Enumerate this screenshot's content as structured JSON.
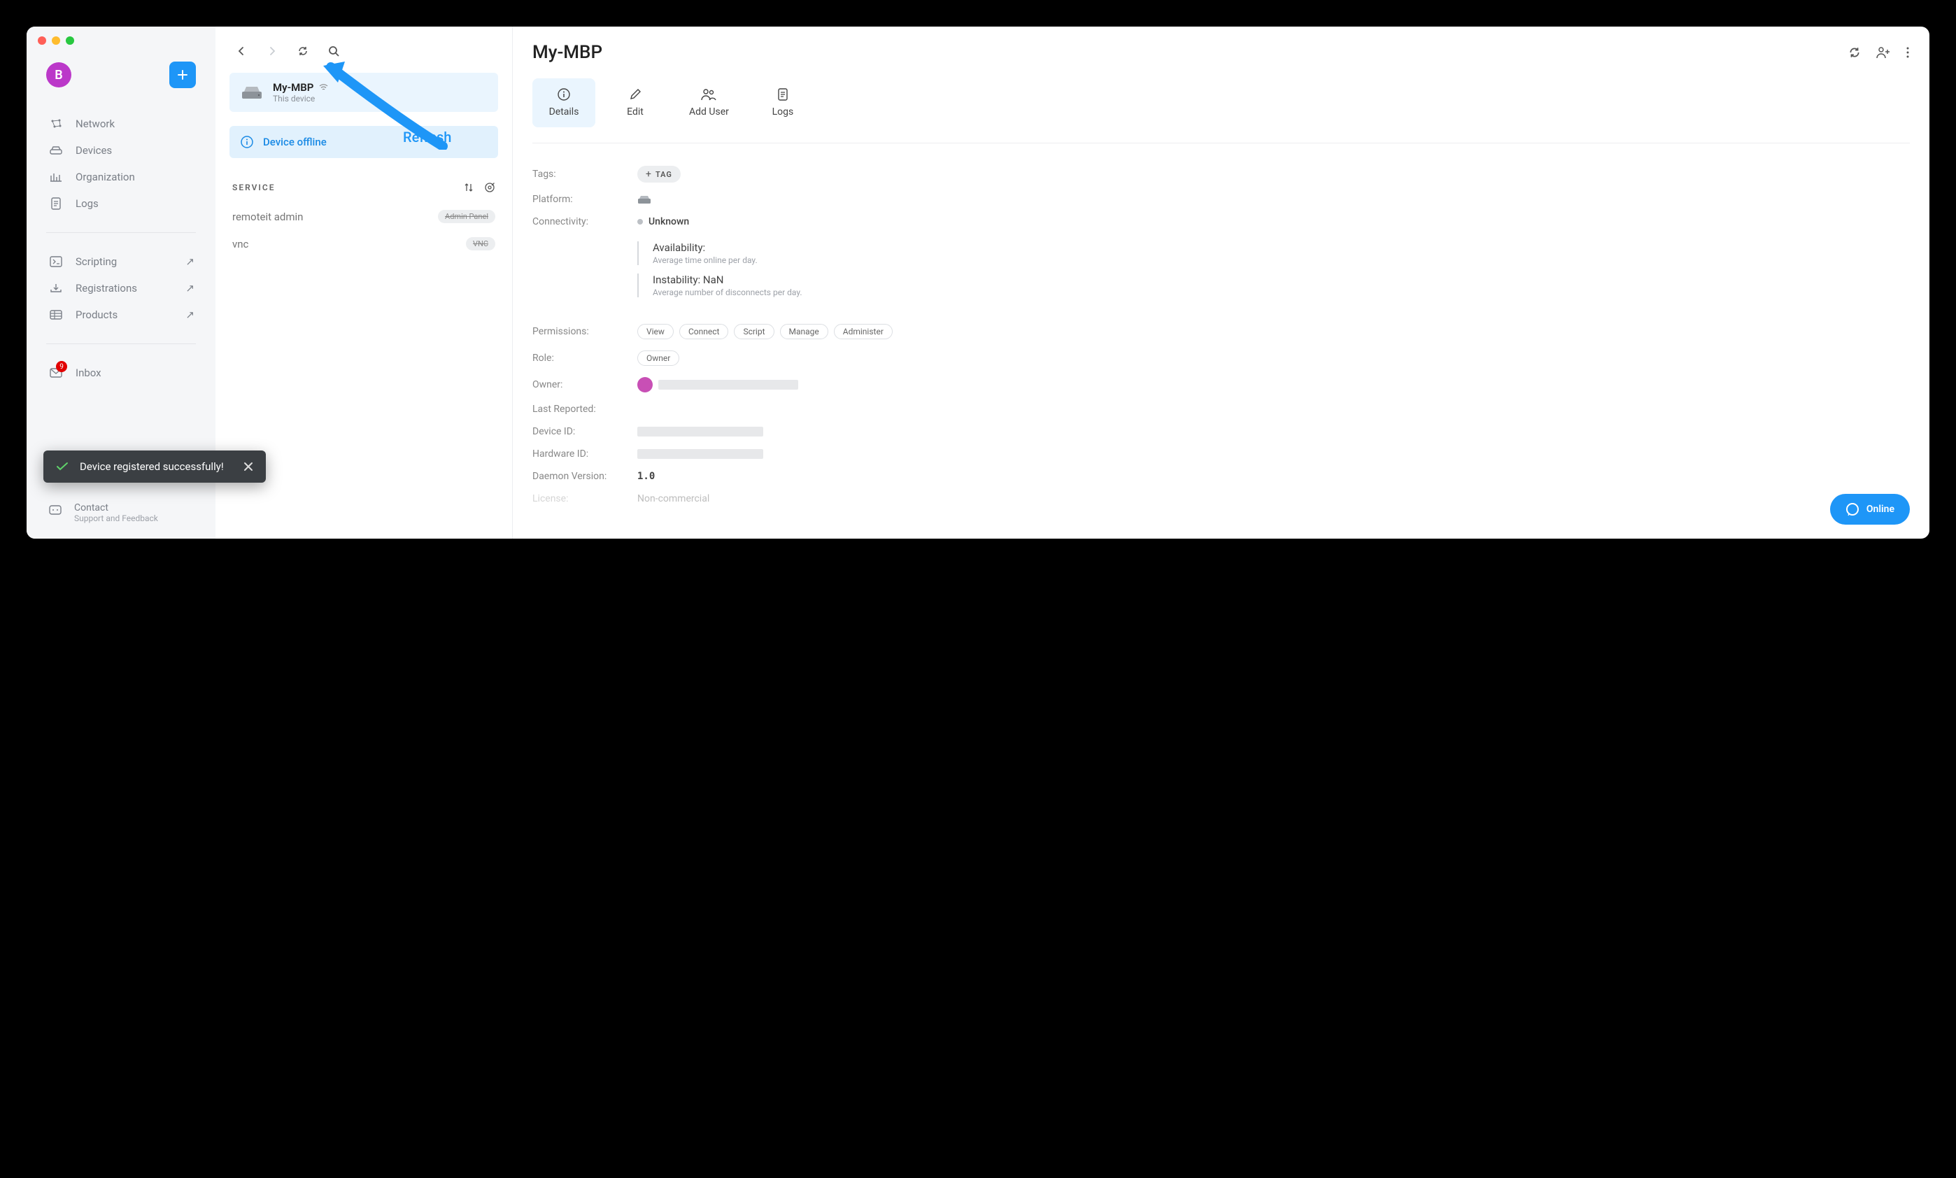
{
  "avatar_initial": "B",
  "sidebar": {
    "items": [
      {
        "label": "Network"
      },
      {
        "label": "Devices"
      },
      {
        "label": "Organization"
      },
      {
        "label": "Logs"
      }
    ],
    "items2": [
      {
        "label": "Scripting"
      },
      {
        "label": "Registrations"
      },
      {
        "label": "Products"
      }
    ],
    "inbox_label": "Inbox",
    "inbox_badge": "9",
    "contact_label": "Contact",
    "contact_sub": "Support and Feedback"
  },
  "middle": {
    "device_name": "My-MBP",
    "device_sub": "This device",
    "alert_text": "Device offline",
    "service_header": "SERVICE",
    "services": [
      {
        "name": "remoteit admin",
        "tag": "Admin Panel"
      },
      {
        "name": "vnc",
        "tag": "VNC"
      }
    ]
  },
  "annotation": {
    "refresh_label": "Refresh"
  },
  "right": {
    "title": "My-MBP",
    "tabs": [
      {
        "label": "Details"
      },
      {
        "label": "Edit"
      },
      {
        "label": "Add User"
      },
      {
        "label": "Logs"
      }
    ],
    "tags_label": "Tags:",
    "tag_btn": "TAG",
    "platform_label": "Platform:",
    "connectivity_label": "Connectivity:",
    "connectivity_value": "Unknown",
    "availability_title": "Availability:",
    "availability_sub": "Average time online per day.",
    "instability_title": "Instability: NaN",
    "instability_sub": "Average number of disconnects per day.",
    "permissions_label": "Permissions:",
    "permissions": [
      "View",
      "Connect",
      "Script",
      "Manage",
      "Administer"
    ],
    "role_label": "Role:",
    "role_value": "Owner",
    "owner_label": "Owner:",
    "last_reported_label": "Last Reported:",
    "device_id_label": "Device ID:",
    "hardware_id_label": "Hardware ID:",
    "daemon_label": "Daemon Version:",
    "daemon_value": "1.0",
    "license_label": "License:",
    "license_value": "Non-commercial"
  },
  "toast": {
    "text": "Device registered successfully!"
  },
  "online_label": "Online"
}
